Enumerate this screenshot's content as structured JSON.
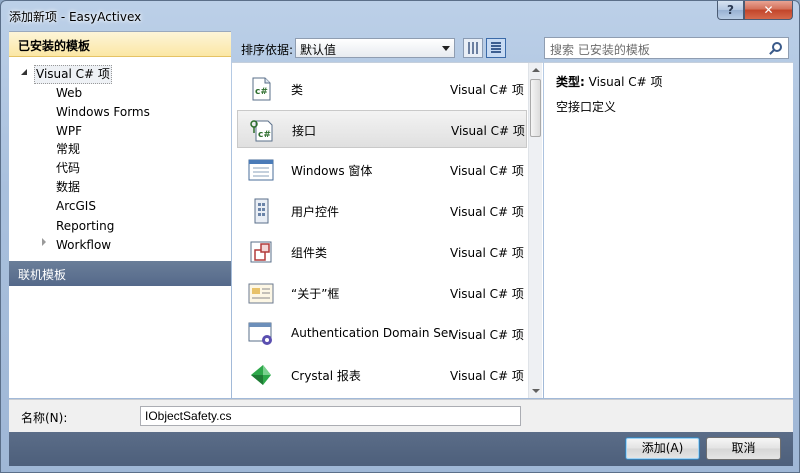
{
  "window": {
    "title": "添加新项 - EasyActivex",
    "help_label": "?",
    "close_label": "✕"
  },
  "left": {
    "installed_header": "已安装的模板",
    "tree": [
      "Visual C# 项",
      "Web",
      "Windows Forms",
      "WPF",
      "常规",
      "代码",
      "数据",
      "ArcGIS",
      "Reporting",
      "Workflow"
    ],
    "online_header": "联机模板"
  },
  "toolbar": {
    "sort_label": "排序依据:",
    "sort_value": "默认值"
  },
  "search": {
    "placeholder": "搜索 已安装的模板"
  },
  "templates": [
    {
      "name": "类",
      "lang": "Visual C# 项",
      "icon": "class-icon"
    },
    {
      "name": "接口",
      "lang": "Visual C# 项",
      "icon": "interface-icon"
    },
    {
      "name": "Windows 窗体",
      "lang": "Visual C# 项",
      "icon": "windows-form-icon"
    },
    {
      "name": "用户控件",
      "lang": "Visual C# 项",
      "icon": "user-control-icon"
    },
    {
      "name": "组件类",
      "lang": "Visual C# 项",
      "icon": "component-class-icon"
    },
    {
      "name": "“关于”框",
      "lang": "Visual C# 项",
      "icon": "about-box-icon"
    },
    {
      "name": "Authentication Domain Serv...",
      "lang": "Visual C# 项",
      "icon": "authentication-icon"
    },
    {
      "name": "Crystal 报表",
      "lang": "Visual C# 项",
      "icon": "crystal-report-icon"
    }
  ],
  "selected_index": 1,
  "description": {
    "type_label": "类型:",
    "type_value": "Visual C# 项",
    "text": "空接口定义"
  },
  "name_field": {
    "label": "名称(N):",
    "value": "IObjectSafety.cs"
  },
  "buttons": {
    "add": "添加(A)",
    "cancel": "取消"
  }
}
